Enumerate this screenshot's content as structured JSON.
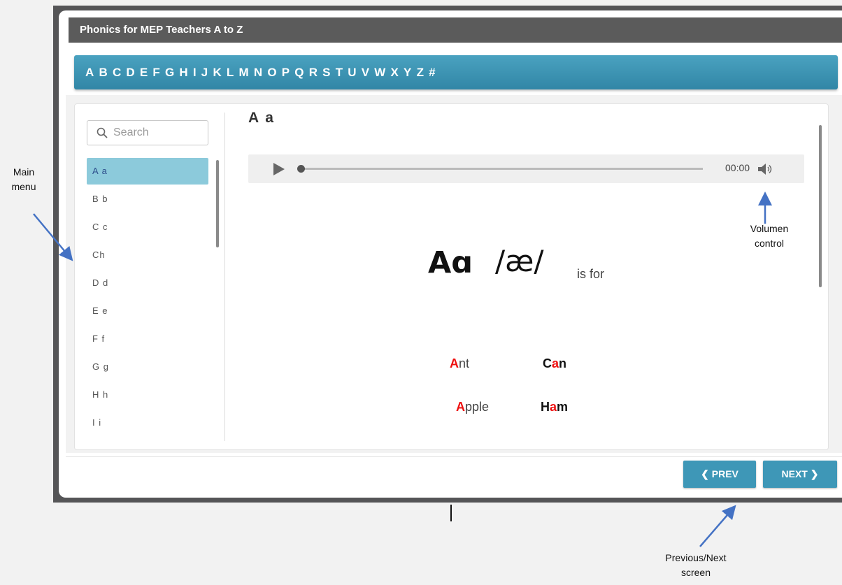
{
  "window": {
    "title": "Phonics for MEP Teachers A to Z"
  },
  "alphabet": [
    "A",
    "B",
    "C",
    "D",
    "E",
    "F",
    "G",
    "H",
    "I",
    "J",
    "K",
    "L",
    "M",
    "N",
    "O",
    "P",
    "Q",
    "R",
    "S",
    "T",
    "U",
    "V",
    "W",
    "X",
    "Y",
    "Z",
    "#"
  ],
  "sidebar": {
    "search_placeholder": "Search",
    "items": [
      "A a",
      "B b",
      "C c",
      "Ch",
      "D d",
      "E e",
      "F f",
      "G g",
      "H h",
      "I i"
    ],
    "active_index": 0
  },
  "main": {
    "title": "A a",
    "player": {
      "time": "00:00"
    },
    "big_letter": "Aɑ",
    "phoneme": "/æ/",
    "is_for": "is for",
    "words": [
      {
        "highlight": "A",
        "rest": "nt"
      },
      {
        "pre": "C",
        "highlight": "a",
        "rest": "n"
      },
      {
        "highlight": "A",
        "rest": "pple"
      },
      {
        "pre": "H",
        "highlight": "a",
        "rest": "m"
      }
    ]
  },
  "nav": {
    "prev_label": "PREV",
    "next_label": "NEXT"
  },
  "annotations": {
    "main_menu_line1": "Main",
    "main_menu_line2": "menu",
    "volume_line1": "Volumen",
    "volume_line2": "control",
    "prevnext_line1": "Previous/Next",
    "prevnext_line2": "screen"
  },
  "colors": {
    "accent": "#3e97b7",
    "highlight": "#e11111",
    "annotation_arrow": "#4472c4"
  }
}
